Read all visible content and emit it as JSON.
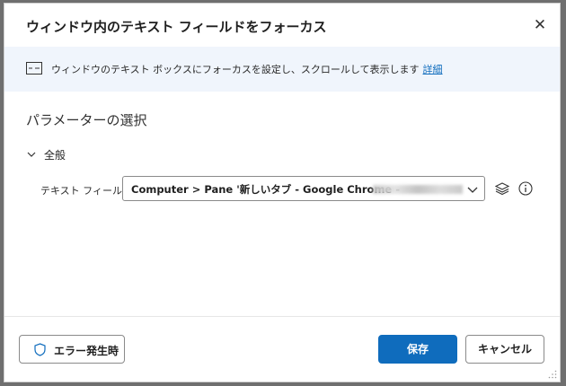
{
  "dialog": {
    "title": "ウィンドウ内のテキスト フィールドをフォーカス",
    "close_icon": "close-icon"
  },
  "banner": {
    "icon": "textbox-icon",
    "text": "ウィンドウのテキスト ボックスにフォーカスを設定し、スクロールして表示します",
    "link": "詳細"
  },
  "parameters": {
    "section_title": "パラメーターの選択",
    "group_label": "全般",
    "text_field": {
      "label": "テキスト フィールド:",
      "value": "Computer > Pane '新しいタブ - Google Chrome -"
    }
  },
  "footer": {
    "error_button": "エラー発生時",
    "save_button": "保存",
    "cancel_button": "キャンセル"
  },
  "colors": {
    "accent": "#0f6cbd",
    "banner_bg": "#f0f5fc"
  }
}
